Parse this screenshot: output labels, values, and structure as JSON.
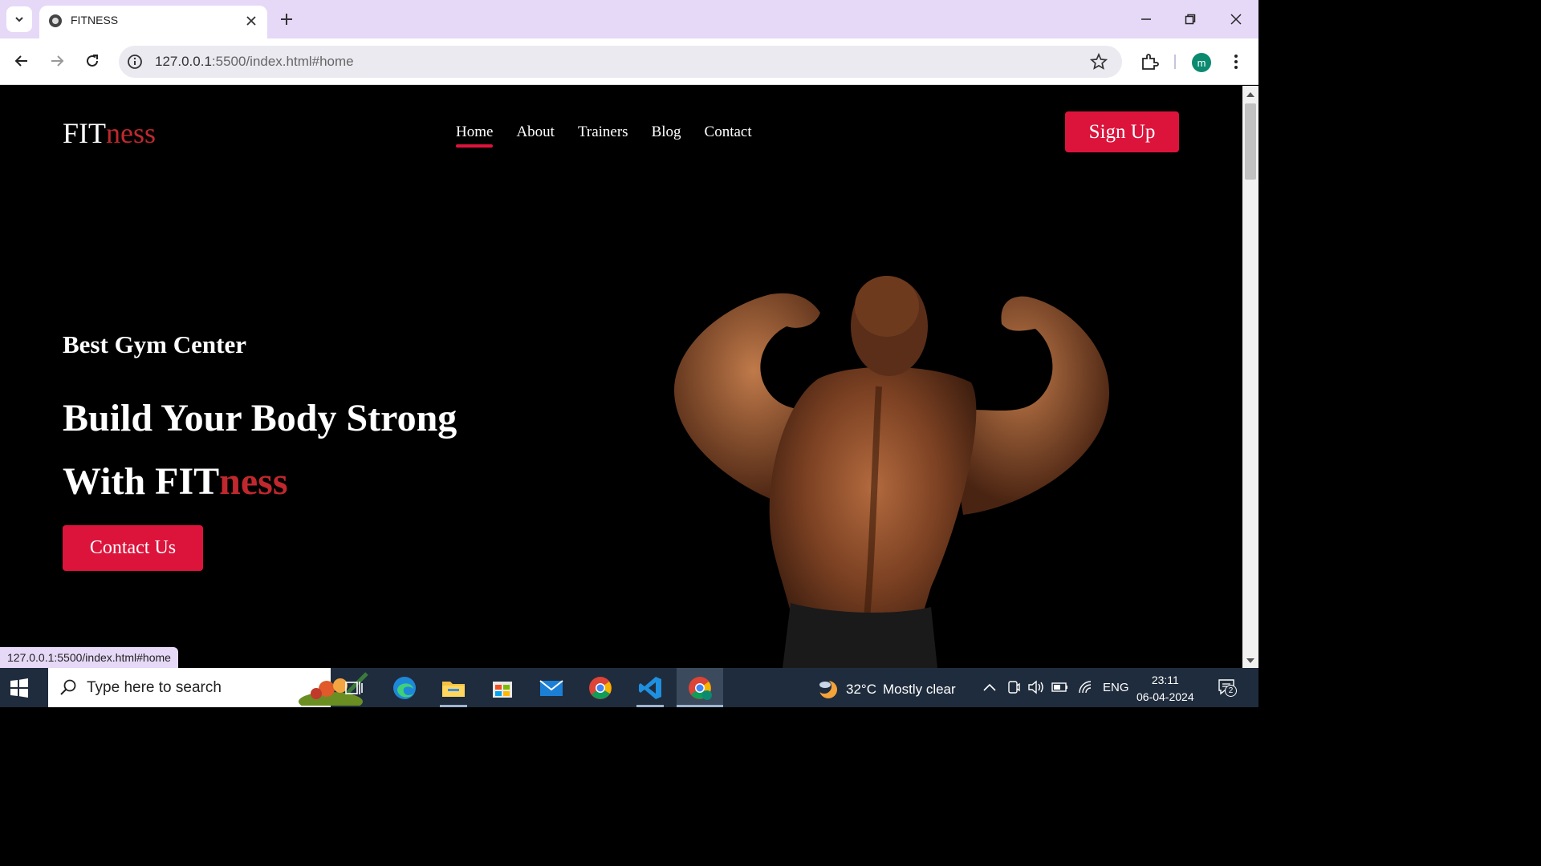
{
  "browser": {
    "tab_title": "FITNESS",
    "url_host": "127.0.0.1",
    "url_rest": ":5500/index.html#home",
    "profile_initial": "m",
    "status_url": "127.0.0.1:5500/index.html#home"
  },
  "site": {
    "logo_main": "FIT",
    "logo_accent": "ness",
    "nav": [
      "Home",
      "About",
      "Trainers",
      "Blog",
      "Contact"
    ],
    "active_nav": "Home",
    "signup_label": "Sign Up",
    "hero": {
      "kicker": "Best Gym Center",
      "title_line1": "Build Your Body Strong",
      "title_line2_prefix": "With FIT",
      "title_line2_accent": "ness",
      "cta_label": "Contact Us"
    },
    "colors": {
      "accent": "#dc143c",
      "logo_accent": "#c0282e",
      "background": "#000000"
    }
  },
  "taskbar": {
    "search_placeholder": "Type here to search",
    "weather_temp": "32°C",
    "weather_text": "Mostly clear",
    "language": "ENG",
    "time": "23:11",
    "date": "06-04-2024",
    "notification_count": "2"
  }
}
